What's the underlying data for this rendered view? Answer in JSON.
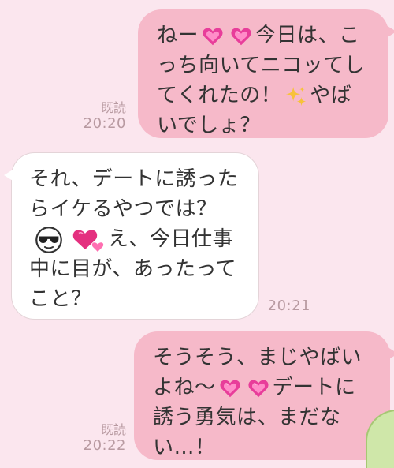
{
  "messages": [
    {
      "direction": "outgoing",
      "lines": [
        [
          {
            "text": "ねー"
          },
          {
            "emoji": "sparkling-heart-icon"
          },
          {
            "emoji": "sparkling-heart-icon"
          },
          {
            "text": "今日は、こ"
          }
        ],
        [
          {
            "text": "っち向いてニコッてし"
          }
        ],
        [
          {
            "text": "てくれたの！"
          },
          {
            "emoji": "sparkles-icon"
          },
          {
            "text": "やば"
          }
        ],
        [
          {
            "text": "いでしょ？"
          }
        ]
      ],
      "read_label": "既読",
      "time": "20:20"
    },
    {
      "direction": "incoming",
      "lines": [
        [
          {
            "text": "それ、デートに誘った"
          }
        ],
        [
          {
            "text": "らイケるやつでは？"
          }
        ],
        [
          {
            "emoji": "sunglasses-face-icon"
          },
          {
            "emoji": "two-hearts-icon"
          },
          {
            "text": "え、今日仕事"
          }
        ],
        [
          {
            "text": "中に目が、あったって"
          }
        ],
        [
          {
            "text": "こと？"
          }
        ]
      ],
      "time": "20:21"
    },
    {
      "direction": "outgoing",
      "lines": [
        [
          {
            "text": "そうそう、まじやばい"
          }
        ],
        [
          {
            "text": "よね〜"
          },
          {
            "emoji": "sparkling-heart-icon"
          },
          {
            "emoji": "sparkling-heart-icon"
          },
          {
            "text": "デートに"
          }
        ],
        [
          {
            "text": "誘う勇気は、まだな"
          }
        ],
        [
          {
            "text": "い…！"
          }
        ]
      ],
      "read_label": "既読",
      "time": "20:22"
    }
  ],
  "colors": {
    "background": "#fbe6ee",
    "outgoing_bubble": "#f6b9c9",
    "incoming_bubble": "#ffffff",
    "meta_text": "#b89aa1",
    "message_text": "#333333"
  }
}
